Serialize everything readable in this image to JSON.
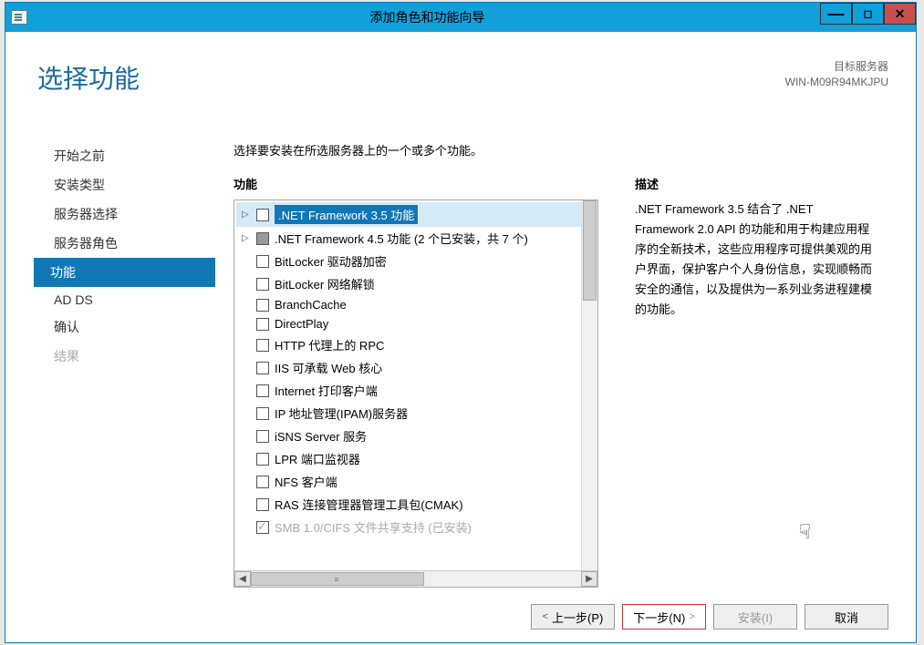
{
  "window": {
    "title": "添加角色和功能向导",
    "buttons": {
      "min": "—",
      "max": "◻",
      "close": "✕"
    }
  },
  "header": {
    "page_title": "选择功能",
    "server_label": "目标服务器",
    "server_name": "WIN-M09R94MKJPU"
  },
  "sidebar": {
    "items": [
      {
        "label": "开始之前",
        "state": "normal"
      },
      {
        "label": "安装类型",
        "state": "normal"
      },
      {
        "label": "服务器选择",
        "state": "normal"
      },
      {
        "label": "服务器角色",
        "state": "normal"
      },
      {
        "label": "功能",
        "state": "active"
      },
      {
        "label": "AD DS",
        "state": "normal"
      },
      {
        "label": "确认",
        "state": "normal"
      },
      {
        "label": "结果",
        "state": "disabled"
      }
    ]
  },
  "content": {
    "instruction": "选择要安装在所选服务器上的一个或多个功能。",
    "features_label": "功能",
    "desc_label": "描述",
    "features": [
      {
        "label": ".NET Framework 3.5 功能",
        "selected": true,
        "expandable": true,
        "check": "empty"
      },
      {
        "label": ".NET Framework 4.5 功能 (2 个已安装，共 7 个)",
        "expandable": true,
        "check": "filled"
      },
      {
        "label": "BitLocker 驱动器加密",
        "check": "empty"
      },
      {
        "label": "BitLocker 网络解锁",
        "check": "empty"
      },
      {
        "label": "BranchCache",
        "check": "empty"
      },
      {
        "label": "DirectPlay",
        "check": "empty"
      },
      {
        "label": "HTTP 代理上的 RPC",
        "check": "empty"
      },
      {
        "label": "IIS 可承载 Web 核心",
        "check": "empty"
      },
      {
        "label": "Internet 打印客户端",
        "check": "empty"
      },
      {
        "label": "IP 地址管理(IPAM)服务器",
        "check": "empty"
      },
      {
        "label": "iSNS Server 服务",
        "check": "empty"
      },
      {
        "label": "LPR 端口监视器",
        "check": "empty"
      },
      {
        "label": "NFS 客户端",
        "check": "empty"
      },
      {
        "label": "RAS 连接管理器管理工具包(CMAK)",
        "check": "empty"
      },
      {
        "label": "SMB 1.0/CIFS 文件共享支持 (已安装)",
        "check": "checked",
        "cutoff": true
      }
    ],
    "description": ".NET Framework 3.5 结合了 .NET Framework 2.0 API 的功能和用于构建应用程序的全新技术，这些应用程序可提供美观的用户界面，保护客户个人身份信息，实现顺畅而安全的通信，以及提供为一系列业务进程建模的功能。"
  },
  "footer": {
    "prev": "上一步(P)",
    "next": "下一步(N)",
    "install": "安装(I)",
    "cancel": "取消"
  },
  "hscroll_thumb": "≡"
}
